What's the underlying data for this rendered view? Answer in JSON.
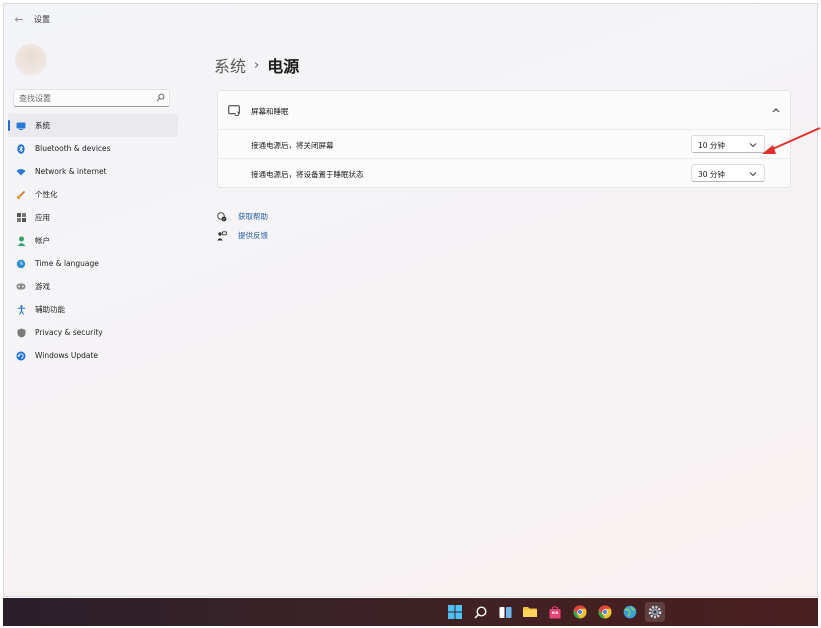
{
  "window": {
    "title": "设置"
  },
  "search": {
    "placeholder": "查找设置"
  },
  "sidebar": {
    "items": [
      {
        "label": "系统",
        "icon": "display-icon",
        "active": true
      },
      {
        "label": "Bluetooth & devices",
        "icon": "bluetooth-icon"
      },
      {
        "label": "Network & internet",
        "icon": "wifi-icon"
      },
      {
        "label": "个性化",
        "icon": "brush-icon"
      },
      {
        "label": "应用",
        "icon": "apps-icon"
      },
      {
        "label": "帐户",
        "icon": "person-icon"
      },
      {
        "label": "Time & language",
        "icon": "globe-clock-icon"
      },
      {
        "label": "游戏",
        "icon": "gamepad-icon"
      },
      {
        "label": "辅助功能",
        "icon": "accessibility-icon"
      },
      {
        "label": "Privacy & security",
        "icon": "shield-icon"
      },
      {
        "label": "Windows Update",
        "icon": "update-icon"
      }
    ]
  },
  "breadcrumb": {
    "parent": "系统",
    "separator": "›",
    "current": "电源"
  },
  "screen_sleep": {
    "title": "屏幕和睡眠",
    "rows": [
      {
        "label": "接通电源后，将关闭屏幕",
        "value": "10 分钟"
      },
      {
        "label": "接通电源后，将设备置于睡眠状态",
        "value": "30 分钟"
      }
    ]
  },
  "links": {
    "help": "获取帮助",
    "feedback": "提供反馈"
  },
  "colors": {
    "accent": "#1a6fcc",
    "link": "#1d5fa6",
    "annotation_arrow": "#e0302a"
  }
}
